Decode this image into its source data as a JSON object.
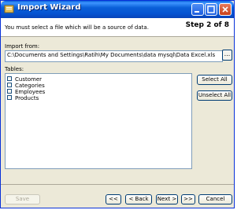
{
  "window": {
    "title": "Import Wizard"
  },
  "header": {
    "step": "Step 2 of 8"
  },
  "description": "You must select a file which will be a source of data.",
  "import": {
    "label": "Import from:",
    "path": "C:\\Documents and Settings\\Ratih\\My Documents\\data mysql\\Data Excel.xls",
    "browse_label": "..."
  },
  "tables": {
    "label": "Tables:",
    "items": [
      "Customer",
      "Categories",
      "Employees",
      "Products"
    ]
  },
  "buttons": {
    "select_all": "Select All",
    "unselect_all": "Unselect All",
    "save": "Save",
    "first": "<<",
    "back": "< Back",
    "next": "Next >",
    "last": ">>",
    "cancel": "Cancel"
  },
  "colors": {
    "title_bar": "#0a5fd8",
    "window_bg": "#ece9d8",
    "close_button": "#c7401b"
  },
  "icons": {
    "title": "import-wizard-icon",
    "minimize": "minimize-icon",
    "maximize": "maximize-icon",
    "close": "close-icon"
  }
}
